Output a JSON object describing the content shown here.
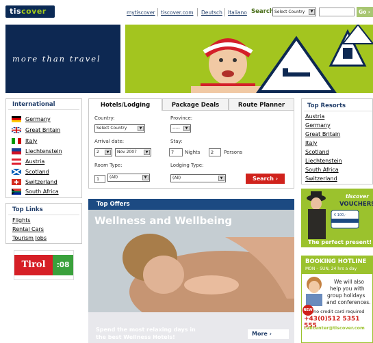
{
  "header": {
    "logo_main": "tis",
    "logo_accent": "cover",
    "links": [
      "mytiscover",
      "tiscover.com",
      "Deutsch",
      "Italiano"
    ],
    "search_label": "Search",
    "country_select": "Select Country",
    "go_label": "Go"
  },
  "banner": {
    "tagline": "more than travel"
  },
  "international": {
    "title": "International",
    "countries": [
      {
        "name": "Germany",
        "flag": "de"
      },
      {
        "name": "Great Britain",
        "flag": "gb"
      },
      {
        "name": "Italy",
        "flag": "it"
      },
      {
        "name": "Liechtenstein",
        "flag": "li"
      },
      {
        "name": "Austria",
        "flag": "at"
      },
      {
        "name": "Scotland",
        "flag": "sc"
      },
      {
        "name": "Switzerland",
        "flag": "ch"
      },
      {
        "name": "South Africa",
        "flag": "za"
      }
    ]
  },
  "top_links": {
    "title": "Top Links",
    "items": [
      "Flights",
      "Rental Cars",
      "Tourism Jobs"
    ]
  },
  "tirol": {
    "word": "Tirol",
    "year": ":08"
  },
  "tabs": [
    "Hotels/Lodging",
    "Package Deals",
    "Route Planner"
  ],
  "form": {
    "country_label": "Country:",
    "country_value": "Select Country",
    "province_label": "Province:",
    "province_value": "-----",
    "arrival_label": "Arrival date:",
    "day_value": "2",
    "month_value": "Nov 2007",
    "stay_label": "Stay:",
    "nights_value": "7",
    "nights_label": "Nights",
    "persons_value": "2",
    "persons_label": "Persons",
    "room_label": "Room Type:",
    "room_count": "1",
    "room_value": "(All)",
    "lodging_label": "Lodging Type:",
    "lodging_value": "(All)",
    "search_button": "Search"
  },
  "offers": {
    "header": "Top Offers",
    "title": "Wellness and Wellbeing",
    "subtitle_1": "Spend the most relaxing days in",
    "subtitle_2": "the best Wellness Hotels!",
    "more": "More"
  },
  "resorts": {
    "title": "Top Resorts",
    "items": [
      "Austria",
      "Germany",
      "Great Britain",
      "Italy",
      "Scotland",
      "Liechtenstein",
      "South Africa",
      "Switzerland"
    ]
  },
  "vouchers": {
    "brand": "tiscover",
    "title": "VOUCHERS",
    "card_value": "€ 100,-",
    "slogan": "The perfect present!"
  },
  "hotline": {
    "title": "BOOKING HOTLINE",
    "hours": "MON – SUN, 24 hrs a day",
    "text_1": "We will also",
    "text_2": "help you with",
    "text_3": "group holidays",
    "text_4": "and conferences.",
    "badge": "NEW",
    "note": "no credit card required",
    "phone": "+43(0)512 5351 555",
    "email": "callcenter@tiscover.com"
  },
  "colors": {
    "navy": "#0d2852",
    "lime": "#a3c51f",
    "red": "#d0221c",
    "link": "#24406b"
  }
}
